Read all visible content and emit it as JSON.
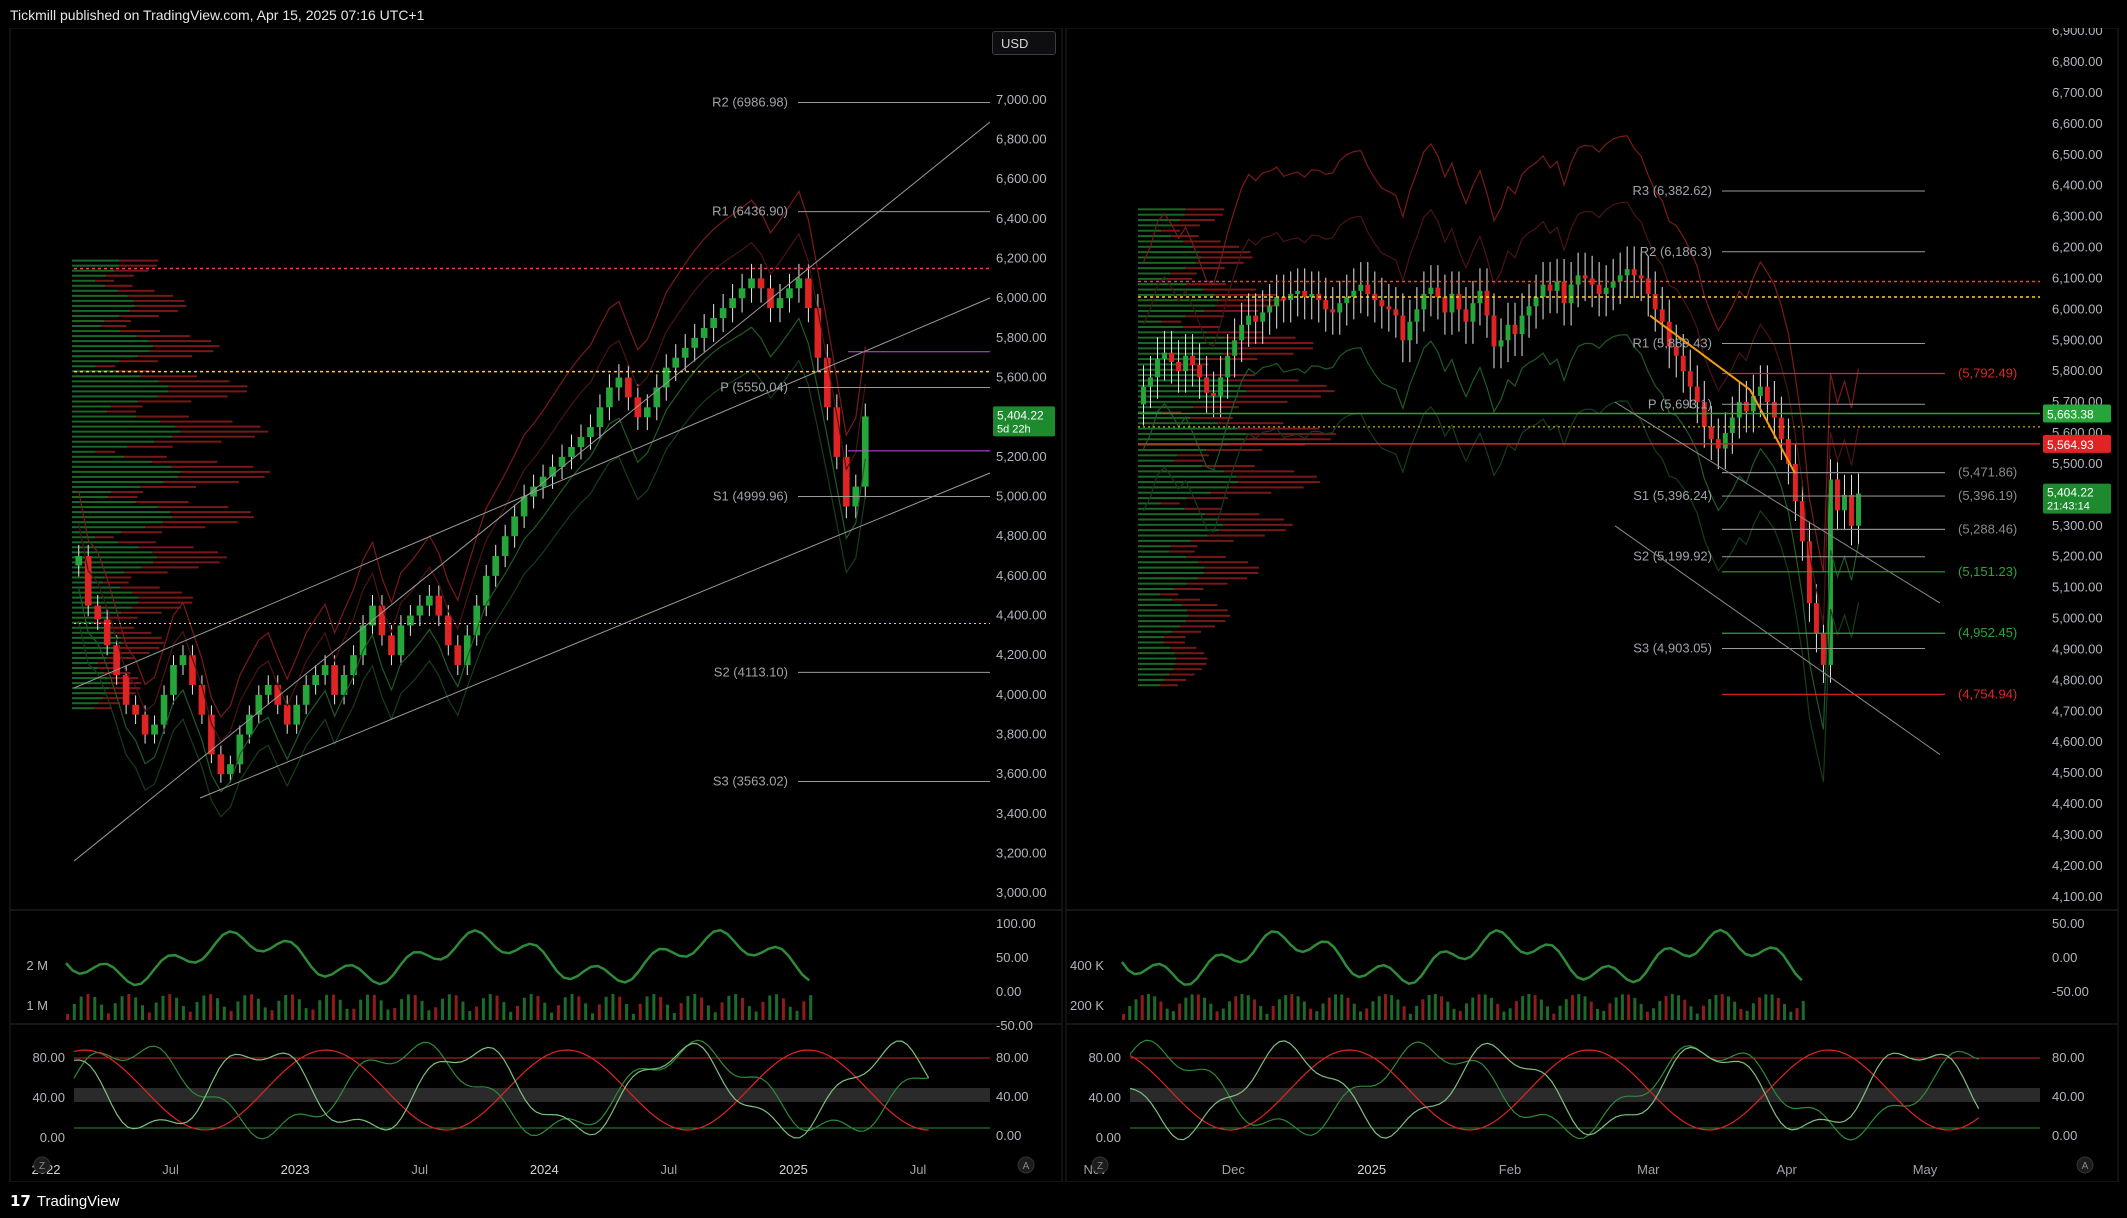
{
  "header": {
    "publisher": "Tickmill published on TradingView.com, Apr 15, 2025 07:16 UTC+1"
  },
  "footer": {
    "brand": "TradingView",
    "brand_glyph": "17"
  },
  "toolbar": {
    "currency": "USD",
    "left_btn": "Z",
    "right_btn": "A"
  },
  "colors": {
    "up": "#26a63a",
    "down": "#e02424",
    "pivot_line": "#9a9a9a",
    "red_dotted": "#ff3b3b",
    "yellow_dotted": "#ffd21e",
    "magenta": "#c54bf0",
    "orange": "#f39c12"
  },
  "chart_data": [
    {
      "type": "candlestick",
      "panel": "left-weekly",
      "x_ticks": [
        "2022",
        "Jul",
        "2023",
        "Jul",
        "2024",
        "Jul",
        "2025",
        "Jul"
      ],
      "y_ticks": [
        "7,000.00",
        "6,800.00",
        "6,600.00",
        "6,400.00",
        "6,200.00",
        "6,000.00",
        "5,800.00",
        "5,600.00",
        "5,400.00",
        "5,200.00",
        "5,000.00",
        "4,800.00",
        "4,600.00",
        "4,400.00",
        "4,200.00",
        "4,000.00",
        "3,800.00",
        "3,600.00",
        "3,400.00",
        "3,200.00",
        "3,000.00"
      ],
      "ylim": [
        2900,
        7050
      ],
      "pivots": [
        {
          "label": "R2 (6986.98)",
          "value": 6986.98
        },
        {
          "label": "R1 (6436.90)",
          "value": 6436.9
        },
        {
          "label": "P (5550.04)",
          "value": 5550.04
        },
        {
          "label": "S1 (4999.96)",
          "value": 4999.96
        },
        {
          "label": "S2 (4113.10)",
          "value": 4113.1
        },
        {
          "label": "S3 (3563.02)",
          "value": 3563.02
        }
      ],
      "price_tag": {
        "value": "5,404.22",
        "sub": "5d 22h"
      },
      "close": [
        4700,
        4450,
        4380,
        4250,
        4100,
        3950,
        3900,
        3800,
        3850,
        4000,
        4150,
        4200,
        4050,
        3900,
        3700,
        3600,
        3650,
        3800,
        3900,
        4000,
        4050,
        3950,
        3850,
        3950,
        4050,
        4100,
        4150,
        4000,
        4100,
        4200,
        4350,
        4450,
        4300,
        4200,
        4350,
        4400,
        4450,
        4500,
        4400,
        4250,
        4150,
        4300,
        4450,
        4600,
        4700,
        4800,
        4900,
        5000,
        5050,
        5100,
        5150,
        5200,
        5250,
        5300,
        5350,
        5450,
        5550,
        5600,
        5500,
        5400,
        5450,
        5550,
        5650,
        5700,
        5750,
        5800,
        5850,
        5900,
        5950,
        6000,
        6050,
        6100,
        6050,
        5950,
        6000,
        6050,
        6100,
        5950,
        5700,
        5450,
        5200,
        4950,
        5050,
        5404
      ]
    },
    {
      "type": "candlestick",
      "panel": "right-daily",
      "x_ticks": [
        "Nov",
        "Dec",
        "2025",
        "Feb",
        "Mar",
        "Apr",
        "May"
      ],
      "y_ticks": [
        "6,900.00",
        "6,800.00",
        "6,700.00",
        "6,600.00",
        "6,500.00",
        "6,400.00",
        "6,300.00",
        "6,200.00",
        "6,100.00",
        "6,000.00",
        "5,900.00",
        "5,800.00",
        "5,700.00",
        "5,600.00",
        "5,500.00",
        "5,400.00",
        "5,300.00",
        "5,200.00",
        "5,100.00",
        "5,000.00",
        "4,900.00",
        "4,800.00",
        "4,700.00",
        "4,600.00",
        "4,500.00",
        "4,400.00",
        "4,300.00",
        "4,200.00",
        "4,100.00"
      ],
      "ylim": [
        4080,
        6910
      ],
      "pivots": [
        {
          "label": "R3 (6,382.62)",
          "value": 6382.62
        },
        {
          "label": "R2 (6,186.3)",
          "value": 6186.3
        },
        {
          "label": "R1 (5,889.43)",
          "value": 5889.43
        },
        {
          "label": "P (5,693.1)",
          "value": 5693.1
        },
        {
          "label": "S1 (5,396.24)",
          "value": 5396.24
        },
        {
          "label": "S2 (5,199.92)",
          "value": 5199.92
        },
        {
          "label": "S3 (4,903.05)",
          "value": 4903.05
        }
      ],
      "levels": [
        {
          "label": "(5,792.49)",
          "value": 5792.49,
          "color": "#e02424"
        },
        {
          "label": "(5,471.86)",
          "value": 5471.86,
          "color": "#8a8a8a"
        },
        {
          "label": "(5,396.19)",
          "value": 5396.19,
          "color": "#8a8a8a"
        },
        {
          "label": "(5,288.46)",
          "value": 5288.46,
          "color": "#8a8a8a"
        },
        {
          "label": "(5,151.23)",
          "value": 5151.23,
          "color": "#26a63a"
        },
        {
          "label": "(4,952.45)",
          "value": 4952.45,
          "color": "#26a63a"
        },
        {
          "label": "(4,754.94)",
          "value": 4754.94,
          "color": "#e02424"
        }
      ],
      "price_tags": [
        {
          "value": "5,663.38",
          "color": "#26a63a"
        },
        {
          "value": "5,564.93",
          "color": "#e02424"
        },
        {
          "value": "5,404.22",
          "sub": "21:43:14",
          "color": "#26a63a"
        }
      ],
      "close": [
        5750,
        5780,
        5840,
        5860,
        5830,
        5800,
        5850,
        5820,
        5780,
        5730,
        5720,
        5780,
        5850,
        5900,
        5950,
        5980,
        5960,
        5990,
        6010,
        6040,
        6030,
        6050,
        6060,
        6040,
        6050,
        6030,
        6000,
        5990,
        6020,
        6040,
        6060,
        6080,
        6050,
        6030,
        6010,
        6000,
        5980,
        5900,
        5960,
        6000,
        6050,
        6070,
        6040,
        5990,
        6050,
        6000,
        5960,
        6020,
        6060,
        5980,
        5880,
        5900,
        5950,
        5920,
        5980,
        6010,
        6040,
        6080,
        6060,
        6090,
        6020,
        6080,
        6110,
        6100,
        6080,
        6050,
        6070,
        6090,
        6110,
        6130,
        6110,
        6100,
        6050,
        6000,
        5960,
        5880,
        5850,
        5800,
        5750,
        5700,
        5620,
        5580,
        5550,
        5600,
        5650,
        5700,
        5670,
        5720,
        5750,
        5700,
        5650,
        5580,
        5500,
        5380,
        5250,
        5050,
        4950,
        4850,
        5450,
        5350,
        5400,
        5300,
        5404
      ]
    }
  ],
  "volume_left": {
    "y_ticks_left": [
      "2 M",
      "1 M"
    ],
    "y_ticks_right": [
      "100.00",
      "50.00",
      "0.00",
      "-50.00"
    ]
  },
  "volume_right": {
    "y_ticks_left": [
      "400 K",
      "200 K"
    ],
    "y_ticks_right": [
      "50.00",
      "0.00",
      "-50.00"
    ]
  },
  "stoch_left": {
    "y_ticks_left": [
      "80.00",
      "40.00",
      "0.00"
    ],
    "y_ticks_right": [
      "80.00",
      "40.00",
      "0.00"
    ]
  },
  "stoch_right": {
    "y_ticks_left": [
      "80.00",
      "40.00",
      "0.00"
    ],
    "y_ticks_right": [
      "80.00",
      "40.00",
      "0.00"
    ]
  }
}
